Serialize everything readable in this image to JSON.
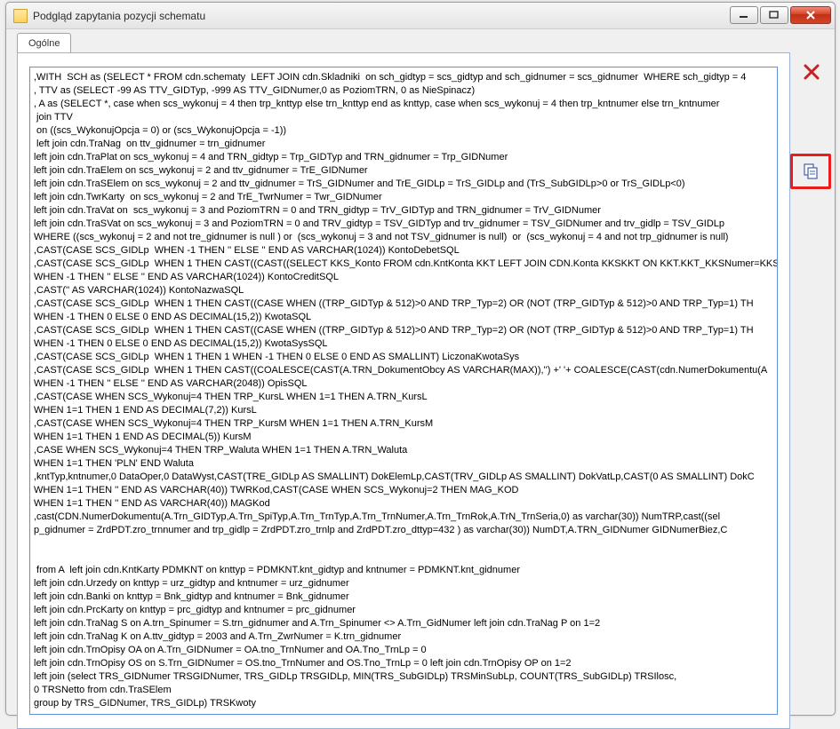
{
  "window": {
    "title": "Podgląd zapytania pozycji schematu"
  },
  "tab": {
    "label": "Ogólne"
  },
  "icons": {
    "close_side": "close-icon",
    "copy_side": "copy-icon"
  },
  "sql_lines": [
    ",WITH  SCH as (SELECT * FROM cdn.schematy  LEFT JOIN cdn.Skladniki  on sch_gidtyp = scs_gidtyp and sch_gidnumer = scs_gidnumer  WHERE sch_gidtyp = 4",
    ", TTV as (SELECT -99 AS TTV_GIDTyp, -999 AS TTV_GIDNumer,0 as PoziomTRN, 0 as NieSpinacz)",
    ", A as (SELECT *, case when scs_wykonuj = 4 then trp_knttyp else trn_knttyp end as knttyp, case when scs_wykonuj = 4 then trp_kntnumer else trn_kntnumer",
    " join TTV",
    " on ((scs_WykonujOpcja = 0) or (scs_WykonujOpcja = -1))",
    " left join cdn.TraNag  on ttv_gidnumer = trn_gidnumer",
    "left join cdn.TraPlat on scs_wykonuj = 4 and TRN_gidtyp = Trp_GIDTyp and TRN_gidnumer = Trp_GIDNumer",
    "left join cdn.TraElem on scs_wykonuj = 2 and ttv_gidnumer = TrE_GIDNumer",
    "left join cdn.TraSElem on scs_wykonuj = 2 and ttv_gidnumer = TrS_GIDNumer and TrE_GIDLp = TrS_GIDLp and (TrS_SubGIDLp>0 or TrS_GIDLp<0)",
    "left join cdn.TwrKarty  on scs_wykonuj = 2 and TrE_TwrNumer = Twr_GIDNumer",
    "left join cdn.TraVat on  scs_wykonuj = 3 and PoziomTRN = 0 and TRN_gidtyp = TrV_GIDTyp and TRN_gidnumer = TrV_GIDNumer",
    "left join cdn.TraSVat on scs_wykonuj = 3 and PoziomTRN = 0 and TRV_gidtyp = TSV_GIDTyp and trv_gidnumer = TSV_GIDNumer and trv_gidlp = TSV_GIDLp",
    "WHERE ((scs_wykonuj = 2 and not tre_gidnumer is null ) or  (scs_wykonuj = 3 and not TSV_gidnumer is null)  or  (scs_wykonuj = 4 and not trp_gidnumer is null)",
    ",CAST(CASE SCS_GIDLp  WHEN -1 THEN '' ELSE '' END AS VARCHAR(1024)) KontoDebetSQL",
    ",CAST(CASE SCS_GIDLp  WHEN 1 THEN CAST((CAST((SELECT KKS_Konto FROM cdn.KntKonta KKT LEFT JOIN CDN.Konta KKSKKT ON KKT.KKT_KKSNumer=KKS",
    "WHEN -1 THEN '' ELSE '' END AS VARCHAR(1024)) KontoCreditSQL",
    ",CAST('' AS VARCHAR(1024)) KontoNazwaSQL",
    ",CAST(CASE SCS_GIDLp  WHEN 1 THEN CAST((CASE WHEN ((TRP_GIDTyp & 512)>0 AND TRP_Typ=2) OR (NOT (TRP_GIDTyp & 512)>0 AND TRP_Typ=1) TH",
    "WHEN -1 THEN 0 ELSE 0 END AS DECIMAL(15,2)) KwotaSQL",
    ",CAST(CASE SCS_GIDLp  WHEN 1 THEN CAST((CASE WHEN ((TRP_GIDTyp & 512)>0 AND TRP_Typ=2) OR (NOT (TRP_GIDTyp & 512)>0 AND TRP_Typ=1) TH",
    "WHEN -1 THEN 0 ELSE 0 END AS DECIMAL(15,2)) KwotaSysSQL",
    ",CAST(CASE SCS_GIDLp  WHEN 1 THEN 1 WHEN -1 THEN 0 ELSE 0 END AS SMALLINT) LiczonaKwotaSys",
    ",CAST(CASE SCS_GIDLp  WHEN 1 THEN CAST((COALESCE(CAST(A.TRN_DokumentObcy AS VARCHAR(MAX)),'') +' '+ COALESCE(CAST(cdn.NumerDokumentu(A",
    "WHEN -1 THEN '' ELSE '' END AS VARCHAR(2048)) OpisSQL",
    ",CAST(CASE WHEN SCS_Wykonuj=4 THEN TRP_KursL WHEN 1=1 THEN A.TRN_KursL",
    "WHEN 1=1 THEN 1 END AS DECIMAL(7,2)) KursL",
    ",CAST(CASE WHEN SCS_Wykonuj=4 THEN TRP_KursM WHEN 1=1 THEN A.TRN_KursM",
    "WHEN 1=1 THEN 1 END AS DECIMAL(5)) KursM",
    ",CASE WHEN SCS_Wykonuj=4 THEN TRP_Waluta WHEN 1=1 THEN A.TRN_Waluta",
    "WHEN 1=1 THEN 'PLN' END Waluta",
    ",kntTyp,kntnumer,0 DataOper,0 DataWyst,CAST(TRE_GIDLp AS SMALLINT) DokElemLp,CAST(TRV_GIDLp AS SMALLINT) DokVatLp,CAST(0 AS SMALLINT) DokC",
    "WHEN 1=1 THEN '' END AS VARCHAR(40)) TWRKod,CAST(CASE WHEN SCS_Wykonuj=2 THEN MAG_KOD",
    "WHEN 1=1 THEN '' END AS VARCHAR(40)) MAGKod",
    ",cast(CDN.NumerDokumentu(A.Trn_GIDTyp,A.Trn_SpiTyp,A.Trn_TrnTyp,A.Trn_TrnNumer,A.Trn_TrnRok,A.TrN_TrnSeria,0) as varchar(30)) NumTRP,cast((sel",
    "p_gidnumer = ZrdPDT.zro_trnnumer and trp_gidlp = ZrdPDT.zro_trnlp and ZrdPDT.zro_dttyp=432 ) as varchar(30)) NumDT,A.TRN_GIDNumer GIDNumerBiez,C",
    "",
    "",
    " from A  left join cdn.KntKarty PDMKNT on knttyp = PDMKNT.knt_gidtyp and kntnumer = PDMKNT.knt_gidnumer",
    "left join cdn.Urzedy on knttyp = urz_gidtyp and kntnumer = urz_gidnumer",
    "left join cdn.Banki on knttyp = Bnk_gidtyp and kntnumer = Bnk_gidnumer",
    "left join cdn.PrcKarty on knttyp = prc_gidtyp and kntnumer = prc_gidnumer",
    "left join cdn.TraNag S on A.trn_Spinumer = S.trn_gidnumer and A.Trn_Spinumer <> A.Trn_GidNumer left join cdn.TraNag P on 1=2",
    "left join cdn.TraNag K on A.ttv_gidtyp = 2003 and A.Trn_ZwrNumer = K.trn_gidnumer",
    "left join cdn.TrnOpisy OA on A.Trn_GIDNumer = OA.tno_TrnNumer and OA.Tno_TrnLp = 0",
    "left join cdn.TrnOpisy OS on S.Trn_GIDNumer = OS.tno_TrnNumer and OS.Tno_TrnLp = 0 left join cdn.TrnOpisy OP on 1=2",
    "left join (select TRS_GIDNumer TRSGIDNumer, TRS_GIDLp TRSGIDLp, MIN(TRS_SubGIDLp) TRSMinSubLp, COUNT(TRS_SubGIDLp) TRSIlosc,",
    "0 TRSNetto from cdn.TraSElem",
    "group by TRS_GIDNumer, TRS_GIDLp) TRSKwoty"
  ]
}
